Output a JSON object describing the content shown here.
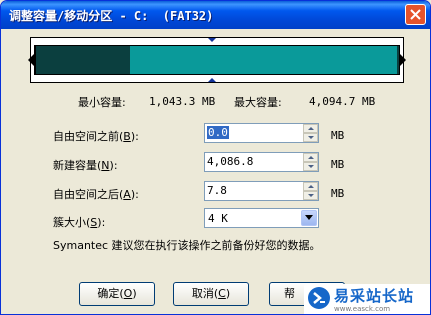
{
  "window": {
    "title": "调整容量/移动分区 - C:  (FAT32)"
  },
  "partition_bar": {
    "before_fraction": 0.0,
    "new_fraction": 0.998,
    "after_fraction": 0.002,
    "colors": {
      "free": "#0b3f3f",
      "used": "#0a9a9a"
    }
  },
  "sizes": {
    "min_label": "最小容量:",
    "min_value": "1,043.3 MB",
    "max_label": "最大容量:",
    "max_value": "4,094.7 MB"
  },
  "fields": [
    {
      "label": "自由空间之前(",
      "hotkey": "B",
      "label_end": "):",
      "value": "0.0",
      "unit": "MB"
    },
    {
      "label": "新建容量(",
      "hotkey": "N",
      "label_end": "):",
      "value": "4,086.8",
      "unit": "MB"
    },
    {
      "label": "自由空间之后(",
      "hotkey": "A",
      "label_end": "):",
      "value": "7.8",
      "unit": "MB"
    }
  ],
  "cluster": {
    "label": "簇大小(",
    "hotkey": "S",
    "label_end": "):",
    "value": "4 K"
  },
  "note": "Symantec 建议您在执行该操作之前备份好您的数据。",
  "buttons": {
    "ok": {
      "label": "确定(",
      "hotkey": "O",
      "end": ")"
    },
    "cancel": {
      "label": "取消(",
      "hotkey": "C",
      "end": ")"
    },
    "help": {
      "label": "帮"
    }
  },
  "watermark": {
    "title": "易采站长站",
    "url": "www.easck.com"
  }
}
